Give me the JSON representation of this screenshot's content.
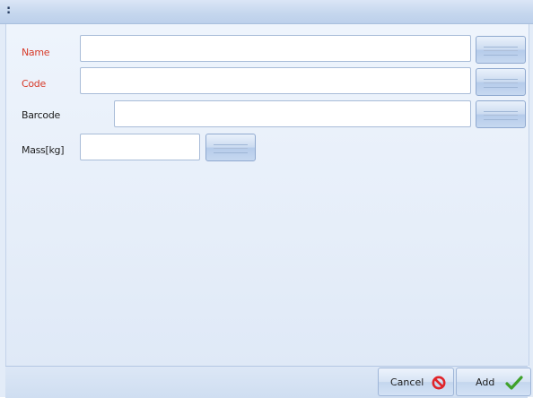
{
  "window": {
    "title": ":"
  },
  "form": {
    "fields": [
      {
        "label": "Name",
        "required": true,
        "value": ""
      },
      {
        "label": "Code",
        "required": true,
        "value": ""
      },
      {
        "label": "Barcode",
        "required": false,
        "value": ""
      },
      {
        "label": "Mass[kg]",
        "required": false,
        "value": ""
      }
    ]
  },
  "actions": {
    "cancel_label": "Cancel",
    "add_label": "Add",
    "cancel_icon": "no-entry-icon",
    "add_icon": "checkmark-icon"
  },
  "colors": {
    "required_label": "#d73b2a",
    "accent": "#c6d7ee",
    "cancel_icon": "#e0242a",
    "add_icon": "#3fa12a"
  }
}
